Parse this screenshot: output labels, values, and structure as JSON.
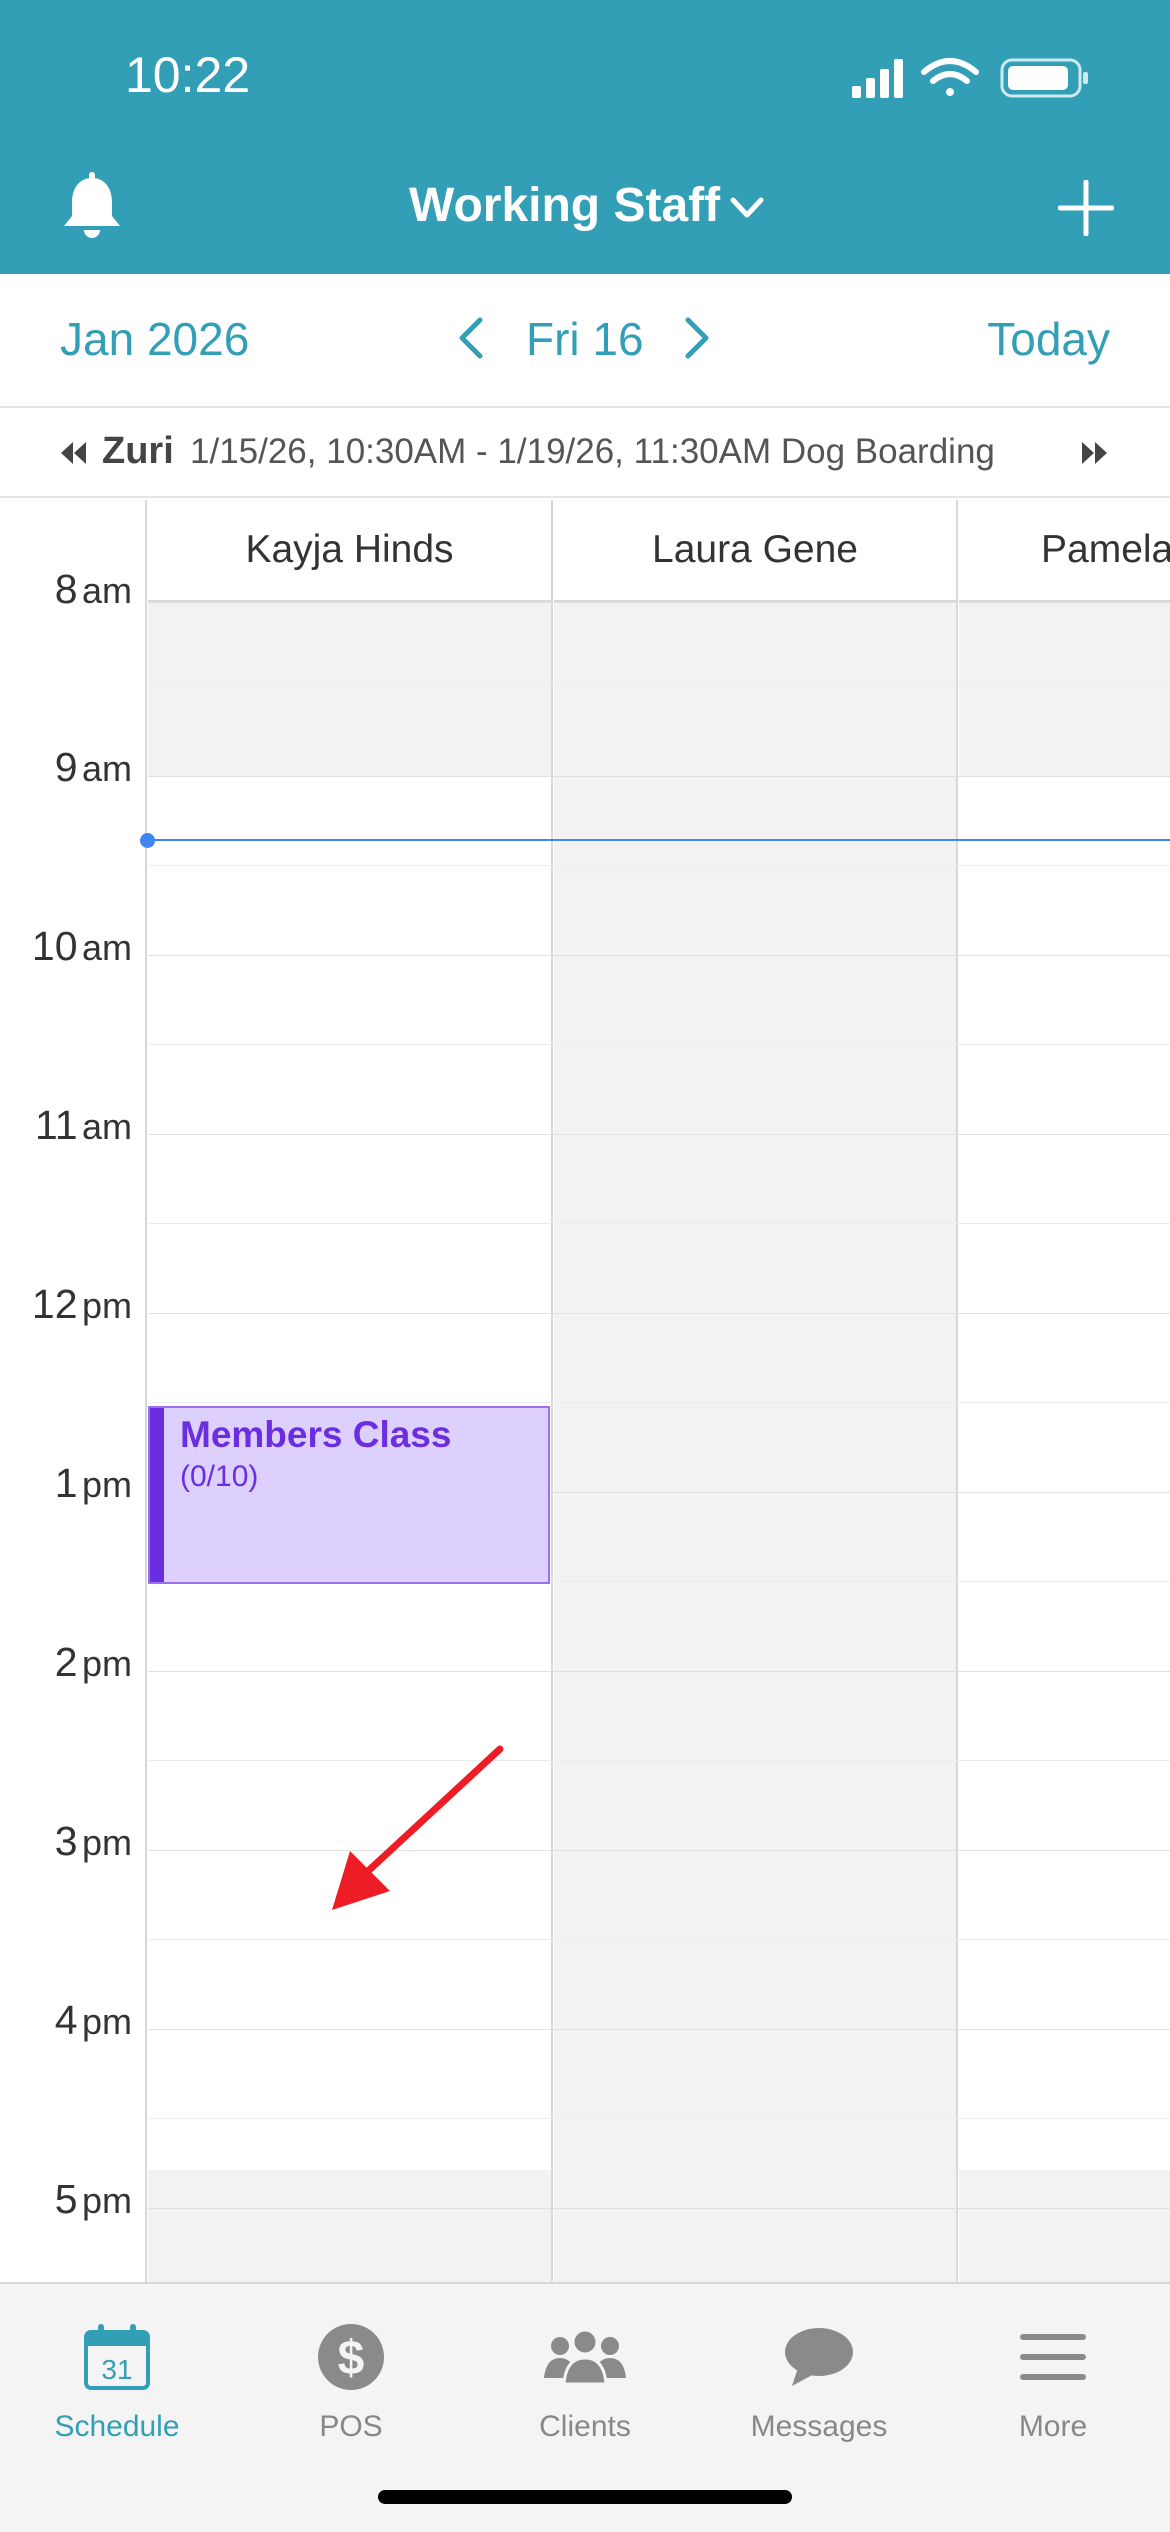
{
  "status_bar": {
    "time": "10:22"
  },
  "header": {
    "title": "Working Staff",
    "bell_icon": "bell-icon",
    "dropdown_icon": "chevron-down-icon",
    "add_icon": "plus-icon",
    "background_color": "#329fb7"
  },
  "date_bar": {
    "month": "Jan 2026",
    "day": "Fri 16",
    "today_label": "Today"
  },
  "reservation_bar": {
    "name": "Zuri",
    "detail": "1/15/26, 10:30AM - 1/19/26, 11:30AM Dog Boarding"
  },
  "times": [
    {
      "h": "8",
      "ap": "am"
    },
    {
      "h": "9",
      "ap": "am"
    },
    {
      "h": "10",
      "ap": "am"
    },
    {
      "h": "11",
      "ap": "am"
    },
    {
      "h": "12",
      "ap": "pm"
    },
    {
      "h": "1",
      "ap": "pm"
    },
    {
      "h": "2",
      "ap": "pm"
    },
    {
      "h": "3",
      "ap": "pm"
    },
    {
      "h": "4",
      "ap": "pm"
    },
    {
      "h": "5",
      "ap": "pm"
    }
  ],
  "staff": [
    "Kayja Hinds",
    "Laura Gene",
    "Pamela"
  ],
  "event": {
    "title": "Members Class",
    "count": "(0/10)",
    "color": "#6a2ee0"
  },
  "tabs": [
    {
      "label": "Schedule",
      "icon": "calendar-icon",
      "calendar_day": "31"
    },
    {
      "label": "POS",
      "icon": "dollar-icon"
    },
    {
      "label": "Clients",
      "icon": "clients-icon"
    },
    {
      "label": "Messages",
      "icon": "messages-icon"
    },
    {
      "label": "More",
      "icon": "menu-icon"
    }
  ],
  "accent_color": "#329fb7"
}
